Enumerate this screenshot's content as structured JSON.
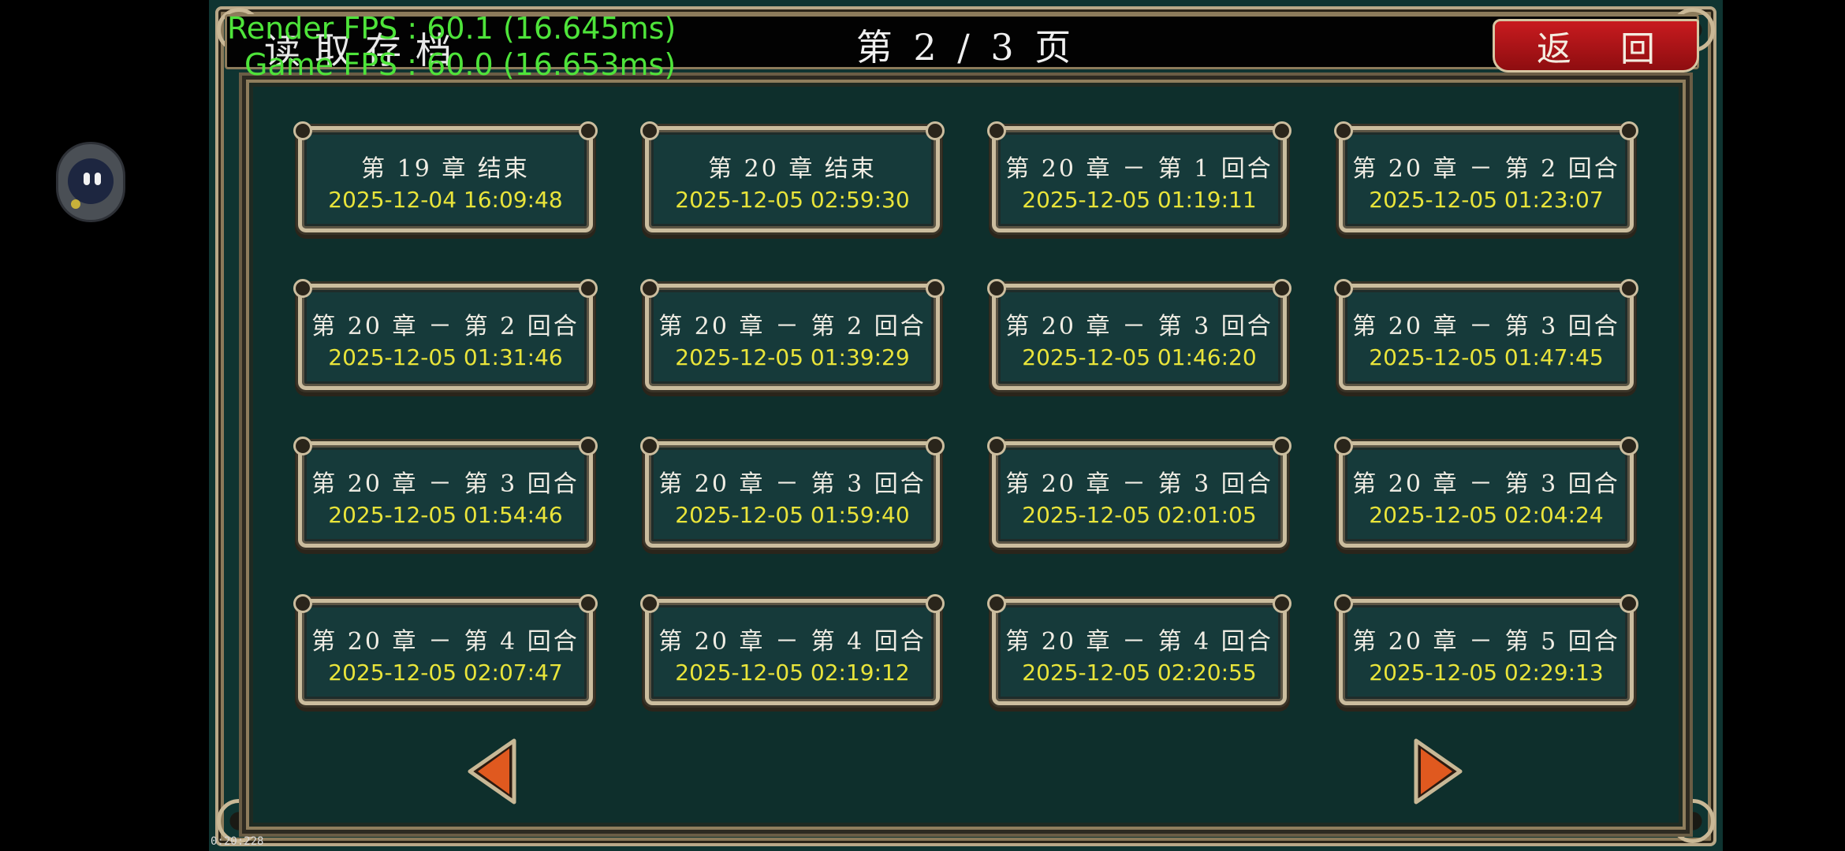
{
  "header": {
    "screen_title": "读取存档",
    "page_indicator": "第 2 / 3 页",
    "back_label": "返 回"
  },
  "debug": {
    "render_fps": "Render FPS : 60.1 (16.645ms)",
    "game_fps": "Game FPS : 60.0 (16.653ms)",
    "timecode": "0:20:228"
  },
  "slots": [
    {
      "label": "第 19 章 结束",
      "time": "2025-12-04 16:09:48"
    },
    {
      "label": "第 20 章 结束",
      "time": "2025-12-05 02:59:30"
    },
    {
      "label": "第 20 章 － 第 1 回合",
      "time": "2025-12-05 01:19:11"
    },
    {
      "label": "第 20 章 － 第 2 回合",
      "time": "2025-12-05 01:23:07"
    },
    {
      "label": "第 20 章 － 第 2 回合",
      "time": "2025-12-05 01:31:46"
    },
    {
      "label": "第 20 章 － 第 2 回合",
      "time": "2025-12-05 01:39:29"
    },
    {
      "label": "第 20 章 － 第 3 回合",
      "time": "2025-12-05 01:46:20"
    },
    {
      "label": "第 20 章 － 第 3 回合",
      "time": "2025-12-05 01:47:45"
    },
    {
      "label": "第 20 章 － 第 3 回合",
      "time": "2025-12-05 01:54:46"
    },
    {
      "label": "第 20 章 － 第 3 回合",
      "time": "2025-12-05 01:59:40"
    },
    {
      "label": "第 20 章 － 第 3 回合",
      "time": "2025-12-05 02:01:05"
    },
    {
      "label": "第 20 章 － 第 3 回合",
      "time": "2025-12-05 02:04:24"
    },
    {
      "label": "第 20 章 － 第 4 回合",
      "time": "2025-12-05 02:07:47"
    },
    {
      "label": "第 20 章 － 第 4 回合",
      "time": "2025-12-05 02:19:12"
    },
    {
      "label": "第 20 章 － 第 4 回合",
      "time": "2025-12-05 02:20:55"
    },
    {
      "label": "第 20 章 － 第 5 回合",
      "time": "2025-12-05 02:29:13"
    }
  ],
  "nav": {
    "prev_icon": "triangle-left-icon",
    "next_icon": "triangle-right-icon",
    "arrow_color": "#e0591f"
  },
  "theme": {
    "slot_time_color": "#e9e43a",
    "back_button_color": "#c81b1f",
    "panel_color": "#0f3431"
  }
}
